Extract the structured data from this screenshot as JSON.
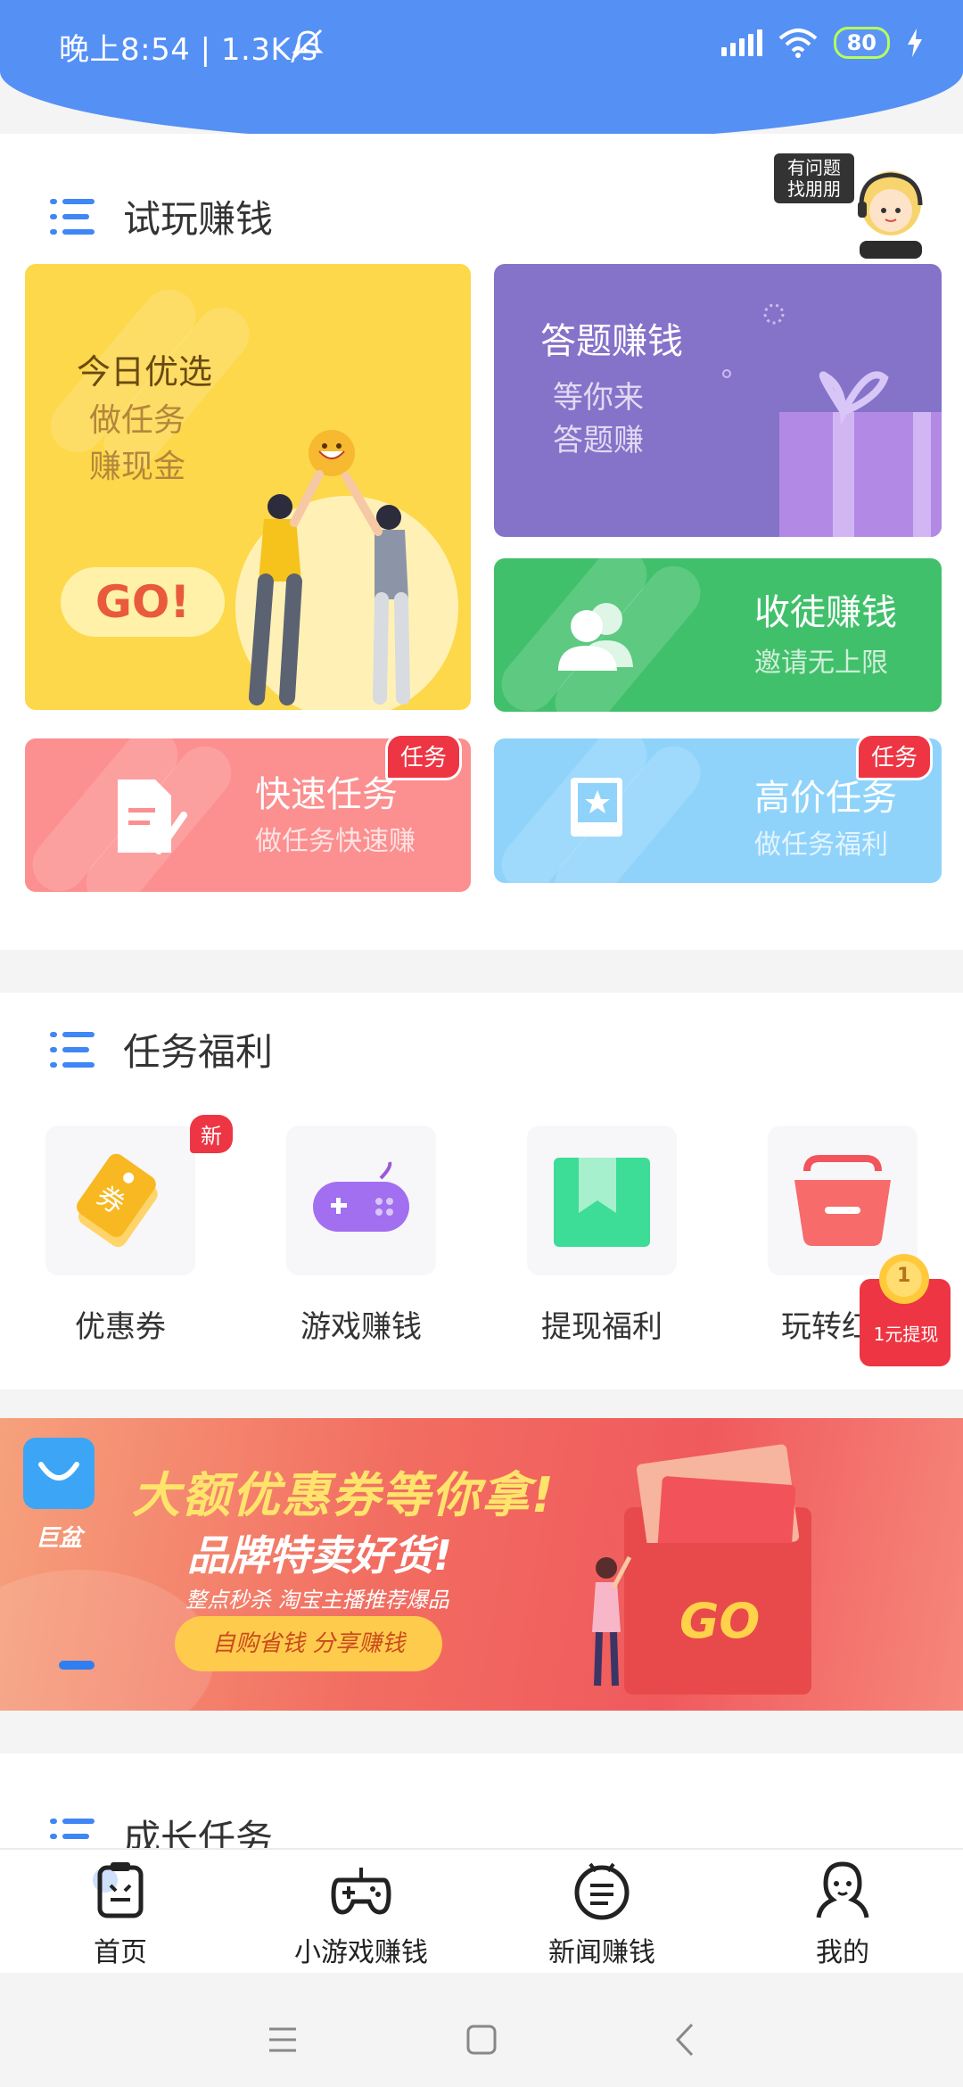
{
  "status_bar": {
    "time_speed": "晚上8:54 | 1.3K/s",
    "battery": "80"
  },
  "section_trial": {
    "title": "试玩赚钱",
    "helper_bubble": "有问题\n找朋朋",
    "card_daily": {
      "title": "今日优选",
      "line1": "做任务",
      "line2": "赚现金",
      "button": "GO!"
    },
    "card_quiz": {
      "title": "答题赚钱",
      "line1": "等你来",
      "line2": "答题赚"
    },
    "card_invite": {
      "title": "收徒赚钱",
      "subtitle": "邀请无上限"
    },
    "card_quick": {
      "title": "快速任务",
      "subtitle": "做任务快速赚",
      "badge": "任务"
    },
    "card_premium": {
      "title": "高价任务",
      "subtitle": "做任务福利",
      "badge": "任务"
    }
  },
  "section_welfare": {
    "title": "任务福利",
    "items": [
      {
        "label": "优惠券",
        "icon": "coupon-icon",
        "badge": "新"
      },
      {
        "label": "游戏赚钱",
        "icon": "gamepad-icon"
      },
      {
        "label": "提现福利",
        "icon": "bookmark-icon"
      },
      {
        "label": "玩转红",
        "icon": "basket-icon"
      }
    ],
    "float_redpack": "1元提现",
    "float_coin": "1"
  },
  "banner": {
    "logo_text": "巨盆",
    "headline": "大额优惠券等你拿!",
    "subheadline": "品牌特卖好货!",
    "tagline": "整点秒杀 淘宝主播推荐爆品",
    "button": "自购省钱 分享赚钱",
    "go": "GO"
  },
  "section_growth": {
    "title": "成长任务"
  },
  "bottom_nav": [
    {
      "label": "首页",
      "icon": "home-icon"
    },
    {
      "label": "小游戏赚钱",
      "icon": "gamepad-icon"
    },
    {
      "label": "新闻赚钱",
      "icon": "news-icon"
    },
    {
      "label": "我的",
      "icon": "profile-icon"
    }
  ],
  "colors": {
    "header_blue": "#5590f5",
    "accent_blue": "#3f86f6",
    "badge_red": "#ee3543"
  }
}
